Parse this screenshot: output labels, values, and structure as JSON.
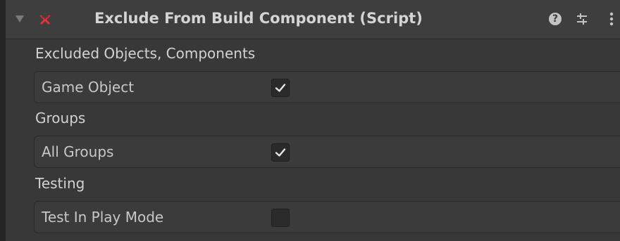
{
  "component": {
    "title": "Exclude From Build Component (Script)",
    "icons": {
      "foldout": "foldout-triangle-icon",
      "script": "script-error-icon",
      "help": "help-icon",
      "preset": "preset-icon",
      "menu": "kebab-menu-icon"
    },
    "help_glyph": "?"
  },
  "sections": [
    {
      "label": "Excluded Objects, Components",
      "field": {
        "label": "Game Object",
        "checked": true
      }
    },
    {
      "label": "Groups",
      "field": {
        "label": "All Groups",
        "checked": true
      }
    },
    {
      "label": "Testing",
      "field": {
        "label": "Test In Play Mode",
        "checked": false
      }
    }
  ],
  "colors": {
    "background": "#383838",
    "header": "#3e3e3e",
    "row": "#3b3b3b",
    "checkbox": "#2a2a2a",
    "checkmark": "#e6e6e6",
    "error_icon": "#e8323c",
    "text": "#d2d2d2"
  }
}
